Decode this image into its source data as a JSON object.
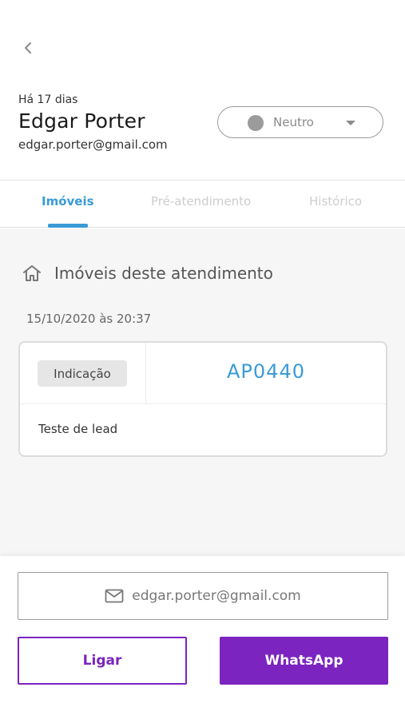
{
  "header": {
    "back_icon": "chevron-left-icon",
    "time_ago": "Há 17 dias",
    "contact_name": "Edgar Porter",
    "contact_email": "edgar.porter@gmail.com",
    "status": {
      "label": "Neutro",
      "dot_color": "#9b9b9b",
      "icon": "caret-down-icon"
    }
  },
  "tabs": [
    {
      "label": "Imóveis",
      "active": true
    },
    {
      "label": "Pré-atendimento",
      "active": false
    },
    {
      "label": "Histórico",
      "active": false
    }
  ],
  "section": {
    "icon": "home-icon",
    "title": "Imóveis deste atendimento",
    "date": "15/10/2020 às 20:37"
  },
  "property_card": {
    "badge": "Indicação",
    "code": "AP0440",
    "note": "Teste de lead"
  },
  "actions": {
    "email_icon": "mail-icon",
    "email_label": "edgar.porter@gmail.com",
    "call_label": "Ligar",
    "whatsapp_label": "WhatsApp"
  },
  "colors": {
    "accent_blue": "#3a9bd6",
    "brand_purple": "#7b24bf"
  }
}
